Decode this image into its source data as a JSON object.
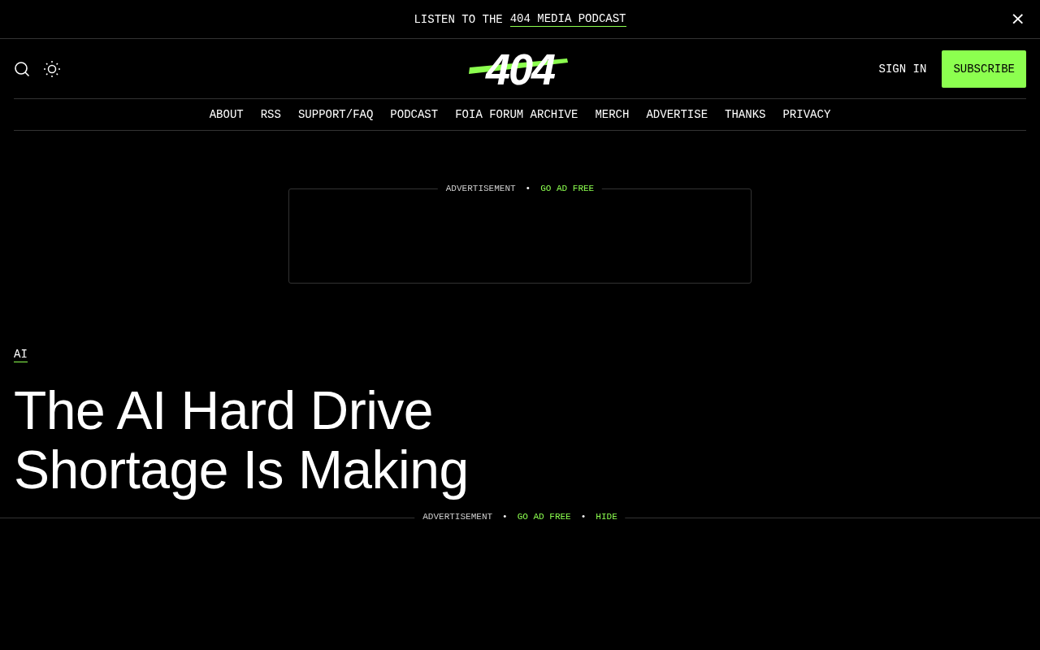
{
  "announcement": {
    "text": "LISTEN TO THE",
    "link": "404 MEDIA PODCAST",
    "close": "×"
  },
  "header": {
    "logo": "404",
    "sign_in": "SIGN IN",
    "subscribe": "SUBSCRIBE"
  },
  "nav": [
    "ABOUT",
    "RSS",
    "SUPPORT/FAQ",
    "PODCAST",
    "FOIA FORUM ARCHIVE",
    "MERCH",
    "ADVERTISE",
    "THANKS",
    "PRIVACY"
  ],
  "ad": {
    "label": "ADVERTISEMENT",
    "separator": "•",
    "link": "GO AD FREE"
  },
  "article": {
    "category": "AI",
    "title": "The AI Hard Drive Shortage Is Making"
  },
  "bottom_ad": {
    "label": "ADVERTISEMENT",
    "separator": "•",
    "link": "GO AD FREE",
    "separator_2": "•",
    "hide": "HIDE"
  }
}
